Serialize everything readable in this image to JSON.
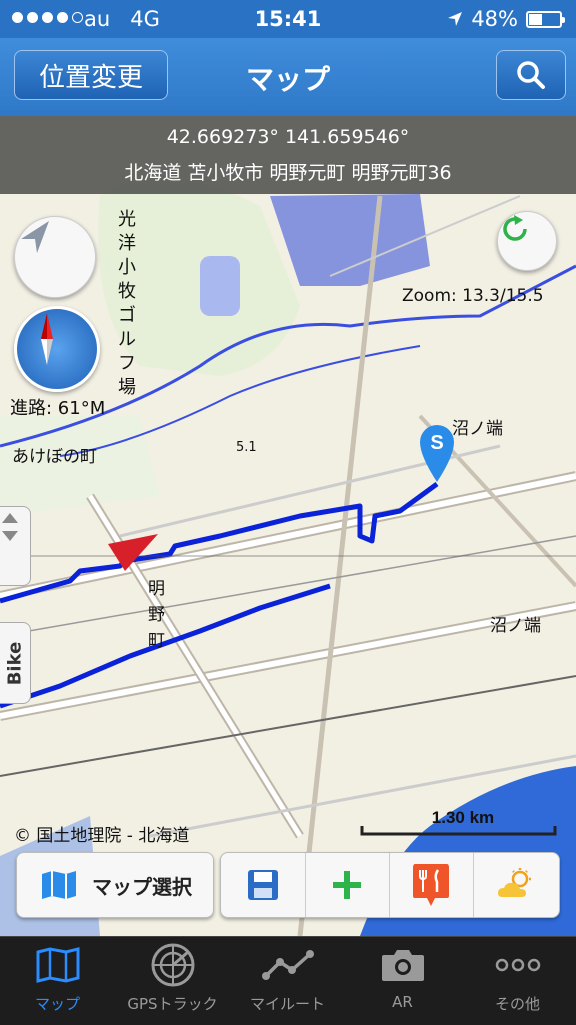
{
  "status_bar": {
    "carrier": "au",
    "network": "4G",
    "time": "15:41",
    "battery_percent": "48%",
    "battery_level": 0.48
  },
  "nav": {
    "left_button": "位置変更",
    "title": "マップ",
    "right_icon": "search-icon"
  },
  "location": {
    "coords": "42.669273° 141.659546°",
    "address": "北海道 苫小牧市 明野元町 明野元町36"
  },
  "map": {
    "zoom_text": "Zoom: 13.3/15.5",
    "heading_text": "進路: 61°M",
    "attribution": "© 国土地理院 - 北海道",
    "scale_text": "1.30 km",
    "start_marker": "S",
    "side_tab_label": "Bike",
    "labels": {
      "golf": "光洋小牧ゴルフ場",
      "akebono": "あけぼの町",
      "numa1": "沼ノ端",
      "numa2": "沼ノ端",
      "akeno": "明野町",
      "height": "5.1"
    }
  },
  "toolbar": {
    "map_select_label": "マップ選択",
    "icons": [
      "save-icon",
      "add-icon",
      "restaurant-icon",
      "weather-icon"
    ]
  },
  "tabs": [
    {
      "label": "マップ",
      "icon": "map-icon",
      "active": true
    },
    {
      "label": "GPSトラック",
      "icon": "radar-icon",
      "active": false
    },
    {
      "label": "マイルート",
      "icon": "route-icon",
      "active": false
    },
    {
      "label": "AR",
      "icon": "camera-icon",
      "active": false
    },
    {
      "label": "その他",
      "icon": "more-icon",
      "active": false
    }
  ],
  "colors": {
    "nav_blue": "#2f78c8",
    "track_blue": "#0a22d8",
    "tab_active": "#2a8cff",
    "marker_red": "#d8202a"
  }
}
